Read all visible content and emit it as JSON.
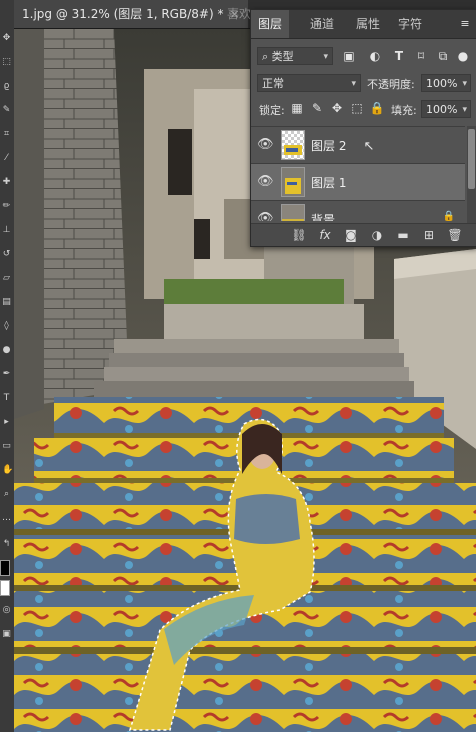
{
  "document_tabs": [
    {
      "label": "1.jpg @ 31.2% (图层 1, RGB/8#) *",
      "close": "×",
      "active": true
    },
    {
      "label": "喜欢",
      "active": false
    }
  ],
  "panel": {
    "tabs": [
      "图层",
      "通道",
      "属性",
      "字符"
    ],
    "filter": {
      "label": "类型",
      "icon": "search-icon"
    },
    "blend_mode": "正常",
    "opacity_label": "不透明度:",
    "opacity_value": "100%",
    "lock_label": "锁定:",
    "fill_label": "填充:",
    "fill_value": "100%",
    "layers": [
      {
        "name": "图层 2",
        "visible": true,
        "selected": false
      },
      {
        "name": "图层 1",
        "visible": true,
        "selected": true
      },
      {
        "name": "背景",
        "visible": true,
        "selected": false
      }
    ]
  },
  "colors": {
    "panel_bg": "#535353",
    "selected_layer": "#6b6b6b",
    "stair_yellow": "#e7c62a",
    "stair_blue": "#4a6fae",
    "stair_red": "#c2432c"
  }
}
